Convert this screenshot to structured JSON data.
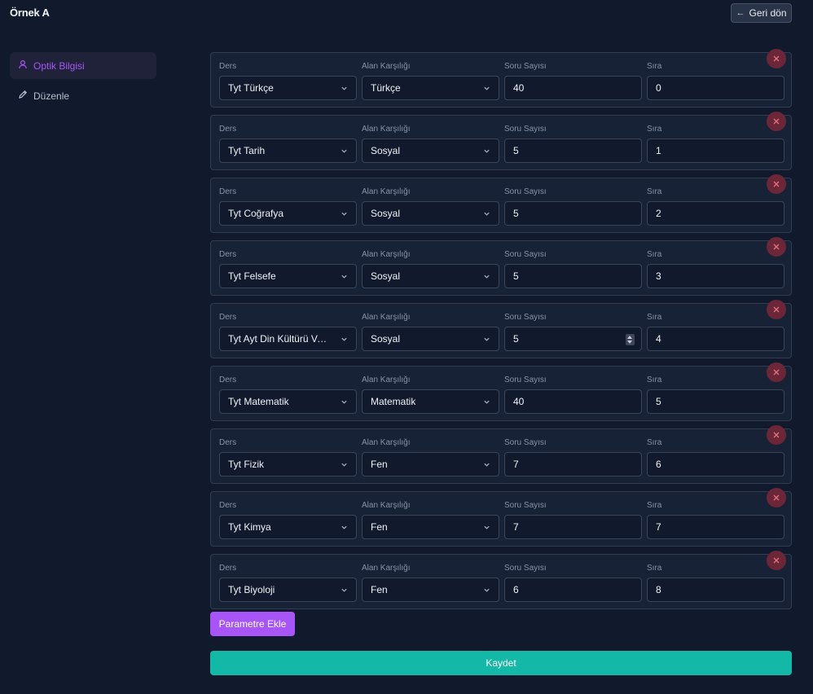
{
  "header": {
    "title": "Örnek A",
    "back_label": "Geri dön"
  },
  "sidebar": {
    "items": [
      {
        "label": "Optik Bilgisi",
        "icon": "user-icon",
        "active": true
      },
      {
        "label": "Düzenle",
        "icon": "pencil-icon",
        "active": false
      }
    ]
  },
  "labels": {
    "ders": "Ders",
    "alan": "Alan Karşılığı",
    "soru": "Soru Sayısı",
    "sira": "Sıra"
  },
  "rows": [
    {
      "ders": "Tyt Türkçe",
      "alan": "Türkçe",
      "soru": "40",
      "sira": "0"
    },
    {
      "ders": "Tyt Tarih",
      "alan": "Sosyal",
      "soru": "5",
      "sira": "1"
    },
    {
      "ders": "Tyt Coğrafya",
      "alan": "Sosyal",
      "soru": "5",
      "sira": "2"
    },
    {
      "ders": "Tyt Felsefe",
      "alan": "Sosyal",
      "soru": "5",
      "sira": "3"
    },
    {
      "ders": "Tyt Ayt Din Kültürü Ve ...",
      "alan": "Sosyal",
      "soru": "5",
      "sira": "4",
      "spinner": true
    },
    {
      "ders": "Tyt Matematik",
      "alan": "Matematik",
      "soru": "40",
      "sira": "5"
    },
    {
      "ders": "Tyt Fizik",
      "alan": "Fen",
      "soru": "7",
      "sira": "6"
    },
    {
      "ders": "Tyt Kimya",
      "alan": "Fen",
      "soru": "7",
      "sira": "7"
    },
    {
      "ders": "Tyt Biyoloji",
      "alan": "Fen",
      "soru": "6",
      "sira": "8"
    }
  ],
  "actions": {
    "add_label": "Parametre Ekle",
    "save_label": "Kaydet"
  },
  "colors": {
    "accent": "#a855f7",
    "save": "#14b8a6",
    "danger": "#6b2637",
    "background": "#111a2c"
  }
}
